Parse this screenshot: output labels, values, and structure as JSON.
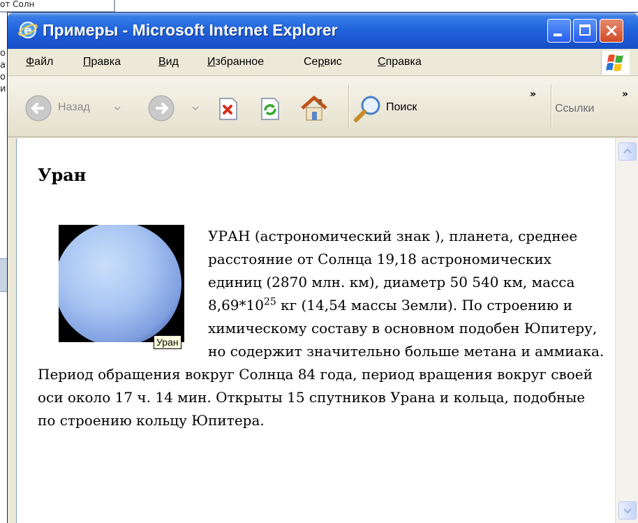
{
  "background": {
    "top_fragment": "от Солн",
    "left_fragments": [
      "о",
      "а",
      "о",
      "и"
    ]
  },
  "window": {
    "title": "Примеры - Microsoft Internet Explorer",
    "controls": {
      "minimize": "minimize",
      "maximize": "maximize",
      "close": "×"
    }
  },
  "menu": [
    {
      "pre": "",
      "u": "Ф",
      "post": "айл"
    },
    {
      "pre": "",
      "u": "П",
      "post": "равка"
    },
    {
      "pre": "",
      "u": "В",
      "post": "ид"
    },
    {
      "pre": "",
      "u": "И",
      "post": "збранное"
    },
    {
      "pre": "Се",
      "u": "р",
      "post": "вис"
    },
    {
      "pre": "",
      "u": "С",
      "post": "правка"
    }
  ],
  "toolbar": {
    "back_label": "Назад",
    "search_label": "Поиск",
    "links_label": "Ссылки",
    "chevron": "»"
  },
  "page": {
    "heading": "Уран",
    "tooltip": "Уран",
    "para_part1": "УРАН (астрономический знак ), планета, среднее расстояние от Солнца 19,18 астрономических единиц (2870 млн. км), диаметр 50 540 км, масса 8,69*10",
    "para_sup": "25",
    "para_part2": " кг (14,54 массы Земли). По строению и химическому составу в основном подобен Юпитеру, но содержит значительно больше метана и аммиака. Период обращения вокруг Солнца 84 года, период вращения вокруг своей оси около 17 ч. 14 мин. Открыты 15 спутников Урана и кольца, подобные по строению кольцу Юпитера."
  },
  "colors": {
    "titlebar": "#2264dc",
    "chrome": "#ece9d8",
    "tooltip_bg": "#ffffe1"
  }
}
